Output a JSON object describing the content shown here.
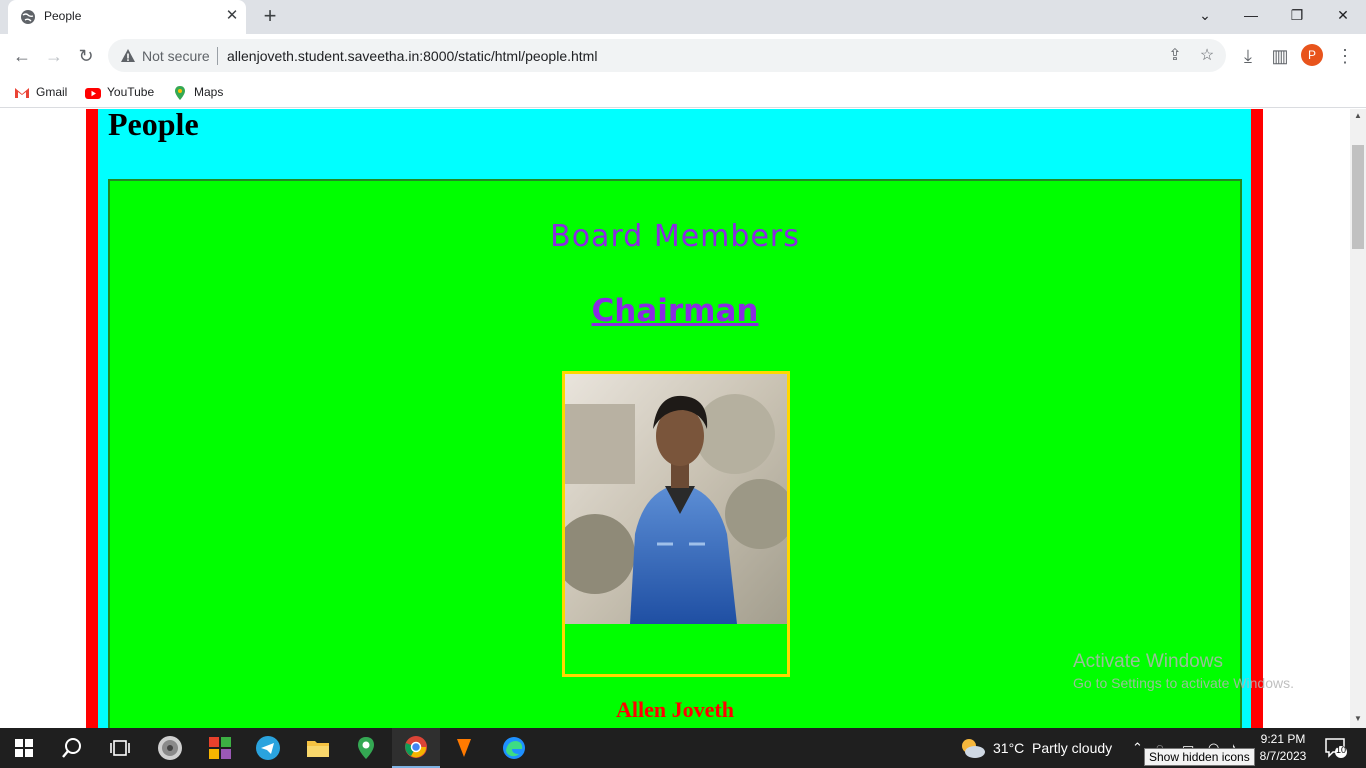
{
  "browser": {
    "tab_title": "People",
    "security_label": "Not secure",
    "url": "allenjoveth.student.saveetha.in:8000/static/html/people.html",
    "profile_initial": "P",
    "bookmarks": [
      {
        "label": "Gmail"
      },
      {
        "label": "YouTube"
      },
      {
        "label": "Maps"
      }
    ]
  },
  "page": {
    "heading": "People",
    "section_title": "Board Members",
    "role_title": "Chairman",
    "member_name": "Allen Joveth",
    "colors": {
      "outer_border": "#ff0000",
      "background": "#00ffff",
      "panel": "#00ff00",
      "title": "#8a2be2",
      "photo_border": "#ffd700",
      "name": "#ff0000"
    }
  },
  "watermark": {
    "line1": "Activate Windows",
    "line2": "Go to Settings to activate Windows."
  },
  "taskbar": {
    "weather_temp": "31°C",
    "weather_condition": "Partly cloudy",
    "time": "9:21 PM",
    "date": "8/7/2023",
    "tooltip": "Show hidden icons",
    "notification_count": "10"
  }
}
